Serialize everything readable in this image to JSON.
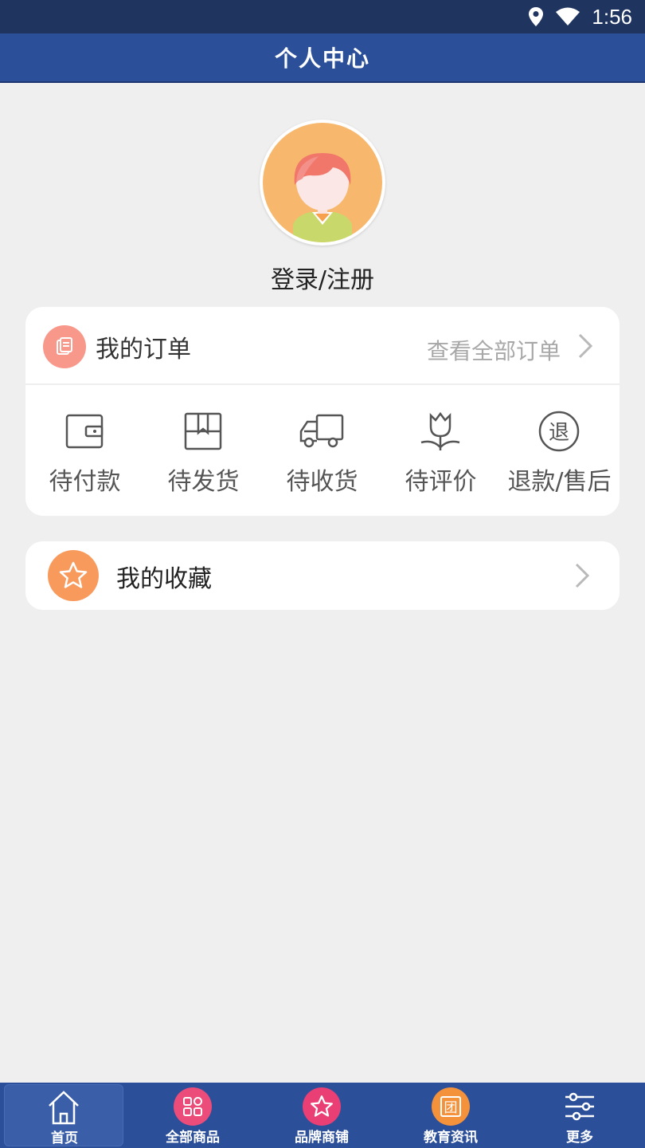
{
  "status_bar": {
    "time": "1:56",
    "icons": [
      "location-icon",
      "wifi-icon"
    ]
  },
  "header": {
    "title": "个人中心"
  },
  "profile": {
    "login_text": "登录/注册",
    "avatar": "avatar-cartoon-girl"
  },
  "orders": {
    "title": "我的订单",
    "view_all": "查看全部订单",
    "statuses": [
      {
        "label": "待付款",
        "icon": "wallet-icon"
      },
      {
        "label": "待发货",
        "icon": "package-icon"
      },
      {
        "label": "待收货",
        "icon": "truck-icon"
      },
      {
        "label": "待评价",
        "icon": "tulip-icon"
      },
      {
        "label": "退款/售后",
        "icon": "refund-icon",
        "glyph": "退"
      }
    ]
  },
  "favorites": {
    "title": "我的收藏"
  },
  "tabbar": {
    "tabs": [
      {
        "label": "首页",
        "icon": "home-icon",
        "active": true
      },
      {
        "label": "全部商品",
        "icon": "grid-icon"
      },
      {
        "label": "品牌商铺",
        "icon": "star-icon"
      },
      {
        "label": "教育资讯",
        "icon": "group-icon",
        "glyph": "团"
      },
      {
        "label": "更多",
        "icon": "sliders-icon"
      }
    ]
  },
  "colors": {
    "header_bg": "#2c4f9a",
    "statusbar_bg": "#1f3560",
    "order_icon": "#f7988a",
    "fav_icon": "#f99a5d",
    "avatar_bg": "#f7b86d"
  }
}
